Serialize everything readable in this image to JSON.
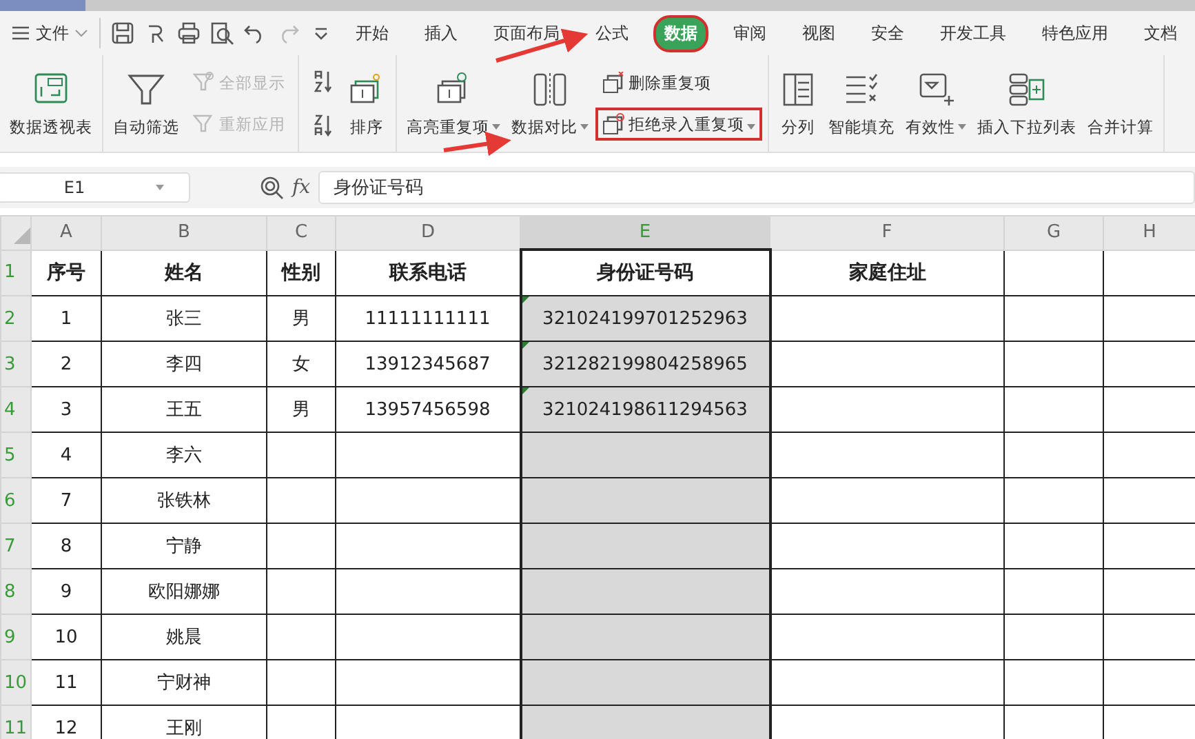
{
  "menu": {
    "file": "文件",
    "tabs": [
      {
        "label": "开始",
        "selected": false,
        "marked": false
      },
      {
        "label": "插入",
        "selected": false,
        "marked": false
      },
      {
        "label": "页面布局",
        "selected": false,
        "marked": false
      },
      {
        "label": "公式",
        "selected": false,
        "marked": false
      },
      {
        "label": "数据",
        "selected": true,
        "marked": true
      },
      {
        "label": "审阅",
        "selected": false,
        "marked": false
      },
      {
        "label": "视图",
        "selected": false,
        "marked": false
      },
      {
        "label": "安全",
        "selected": false,
        "marked": false
      },
      {
        "label": "开发工具",
        "selected": false,
        "marked": false
      },
      {
        "label": "特色应用",
        "selected": false,
        "marked": false
      },
      {
        "label": "文档",
        "selected": false,
        "marked": false
      }
    ]
  },
  "ribbon": {
    "groups": [
      {
        "items": [
          {
            "kind": "large",
            "label": "数据透视表",
            "dropdown": false
          }
        ]
      },
      {
        "items": [
          {
            "kind": "large",
            "label": "自动筛选",
            "dropdown": false
          },
          {
            "kind": "stack",
            "items": [
              {
                "label": "全部显示",
                "disabled": true,
                "dropdown": false,
                "marked": false
              },
              {
                "label": "重新应用",
                "disabled": true,
                "dropdown": false,
                "marked": false
              }
            ]
          }
        ]
      },
      {
        "items": [
          {
            "kind": "sorticons"
          },
          {
            "kind": "large",
            "label": "排序",
            "dropdown": false
          }
        ]
      },
      {
        "items": [
          {
            "kind": "large",
            "label": "高亮重复项",
            "dropdown": true
          },
          {
            "kind": "large",
            "label": "数据对比",
            "dropdown": true
          },
          {
            "kind": "stack",
            "items": [
              {
                "label": "删除重复项",
                "disabled": false,
                "dropdown": false,
                "marked": false
              },
              {
                "label": "拒绝录入重复项",
                "disabled": false,
                "dropdown": true,
                "marked": true
              }
            ]
          }
        ]
      },
      {
        "items": [
          {
            "kind": "large",
            "label": "分列",
            "dropdown": false
          },
          {
            "kind": "large",
            "label": "智能填充",
            "dropdown": false
          },
          {
            "kind": "large",
            "label": "有效性",
            "dropdown": true
          },
          {
            "kind": "large",
            "label": "插入下拉列表",
            "dropdown": false
          },
          {
            "kind": "large",
            "label": "合并计算",
            "dropdown": false
          }
        ]
      }
    ]
  },
  "formula_bar": {
    "cell": "E1",
    "fx": "fx",
    "value": "身份证号码"
  },
  "sheet": {
    "columns": [
      {
        "letter": "A",
        "selected": false
      },
      {
        "letter": "B",
        "selected": false
      },
      {
        "letter": "C",
        "selected": false
      },
      {
        "letter": "D",
        "selected": false
      },
      {
        "letter": "E",
        "selected": true
      },
      {
        "letter": "F",
        "selected": false
      },
      {
        "letter": "G",
        "selected": false
      },
      {
        "letter": "H",
        "selected": false
      }
    ],
    "rows": [
      {
        "number": "1",
        "header": true,
        "marker": false,
        "cells": {
          "A": "序号",
          "B": "姓名",
          "C": "性别",
          "D": "联系电话",
          "E": "身份证号码",
          "F": "家庭住址"
        }
      },
      {
        "number": "2",
        "header": false,
        "marker": true,
        "cells": {
          "A": "1",
          "B": "张三",
          "C": "男",
          "D": "11111111111",
          "E": "321024199701252963"
        }
      },
      {
        "number": "3",
        "header": false,
        "marker": true,
        "cells": {
          "A": "2",
          "B": "李四",
          "C": "女",
          "D": "13912345687",
          "E": "321282199804258965"
        }
      },
      {
        "number": "4",
        "header": false,
        "marker": true,
        "cells": {
          "A": "3",
          "B": "王五",
          "C": "男",
          "D": "13957456598",
          "E": "321024198611294563"
        }
      },
      {
        "number": "5",
        "header": false,
        "marker": false,
        "cells": {
          "A": "4",
          "B": "李六"
        }
      },
      {
        "number": "6",
        "header": false,
        "marker": false,
        "cells": {
          "A": "7",
          "B": "张铁林"
        }
      },
      {
        "number": "7",
        "header": false,
        "marker": false,
        "cells": {
          "A": "8",
          "B": "宁静"
        }
      },
      {
        "number": "8",
        "header": false,
        "marker": false,
        "cells": {
          "A": "9",
          "B": "欧阳娜娜"
        }
      },
      {
        "number": "9",
        "header": false,
        "marker": false,
        "cells": {
          "A": "10",
          "B": "姚晨"
        }
      },
      {
        "number": "10",
        "header": false,
        "marker": false,
        "cells": {
          "A": "11",
          "B": "宁财神"
        }
      },
      {
        "number": "11",
        "header": false,
        "marker": false,
        "cells": {
          "A": "12",
          "B": "王刚"
        }
      }
    ]
  }
}
